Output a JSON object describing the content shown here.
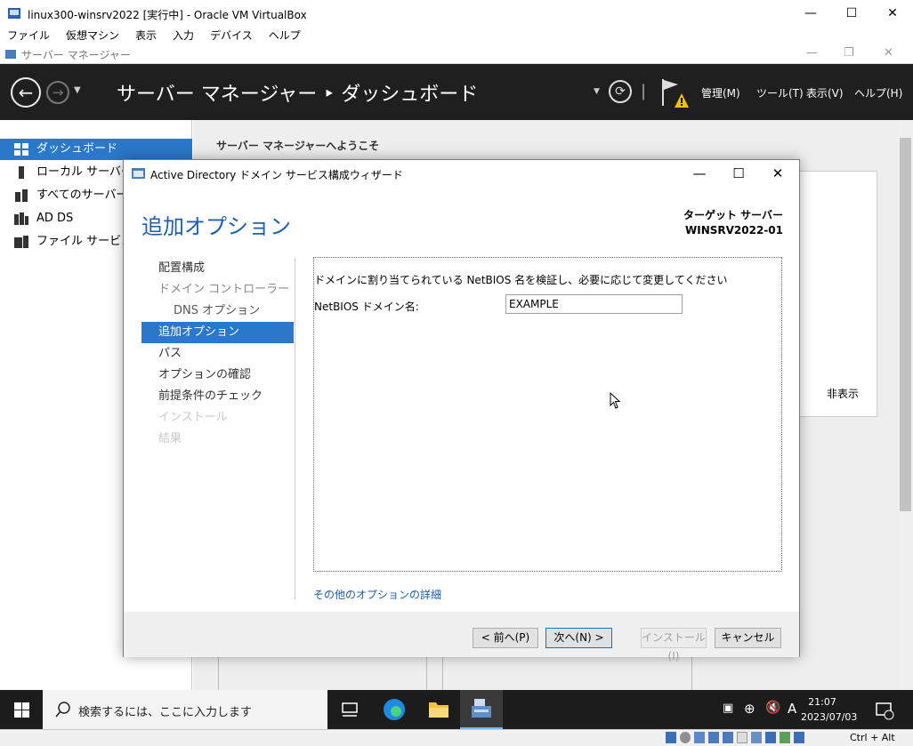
{
  "vbox": {
    "title": "linux300-winsrv2022 [実行中] - Oracle VM VirtualBox",
    "menu": [
      "ファイル",
      "仮想マシン",
      "表示",
      "入力",
      "デバイス",
      "ヘルプ"
    ],
    "host_key": "Ctrl + Alt"
  },
  "server_manager": {
    "window_title": "サーバー マネージャー",
    "breadcrumb": "サーバー マネージャー ‣ ダッシュボード",
    "menus": [
      "管理(M)",
      "ツール(T)",
      "表示(V)",
      "ヘルプ(H)"
    ],
    "nav": [
      {
        "label": "ダッシュボード",
        "icon": "dashboard-icon"
      },
      {
        "label": "ローカル サーバー",
        "icon": "server-icon"
      },
      {
        "label": "すべてのサーバー",
        "icon": "servers-icon"
      },
      {
        "label": "AD DS",
        "icon": "adds-icon"
      },
      {
        "label": "ファイル サービスと記",
        "icon": "file-services-icon"
      }
    ],
    "welcome": "サーバー マネージャーへようこそ",
    "hide_label": "非表示"
  },
  "wizard": {
    "title": "Active Directory ドメイン サービス構成ウィザード",
    "heading": "追加オプション",
    "target_label": "ターゲット サーバー",
    "target_server": "WINSRV2022-01",
    "steps": [
      {
        "label": "配置構成",
        "state": "done"
      },
      {
        "label": "ドメイン コントローラー オプション",
        "state": "dim"
      },
      {
        "label": "DNS オプション",
        "state": "sub"
      },
      {
        "label": "追加オプション",
        "state": "active"
      },
      {
        "label": "パス",
        "state": "done"
      },
      {
        "label": "オプションの確認",
        "state": "done"
      },
      {
        "label": "前提条件のチェック",
        "state": "done"
      },
      {
        "label": "インストール",
        "state": "disabled"
      },
      {
        "label": "結果",
        "state": "disabled"
      }
    ],
    "description": "ドメインに割り当てられている NetBIOS 名を検証し、必要に応じて変更してください",
    "netbios_label": "NetBIOS ドメイン名:",
    "netbios_value": "EXAMPLE",
    "more_link": "その他のオプションの詳細",
    "buttons": {
      "prev": "< 前へ(P)",
      "next": "次へ(N) >",
      "install": "インストール(I)",
      "cancel": "キャンセル"
    }
  },
  "taskbar": {
    "search_placeholder": "検索するには、ここに入力します",
    "time": "21:07",
    "date": "2023/07/03",
    "ime": "A"
  }
}
